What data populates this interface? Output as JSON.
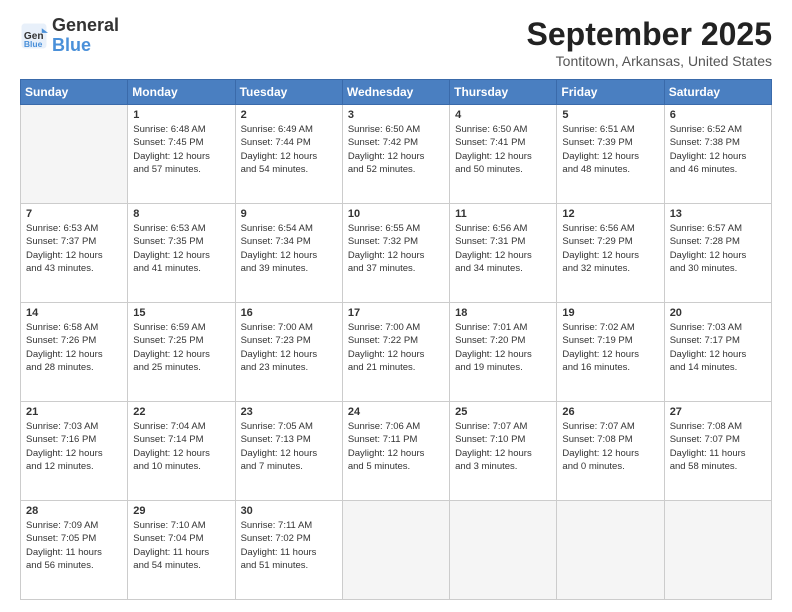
{
  "logo": {
    "line1": "General",
    "line2": "Blue"
  },
  "title": "September 2025",
  "subtitle": "Tontitown, Arkansas, United States",
  "weekdays": [
    "Sunday",
    "Monday",
    "Tuesday",
    "Wednesday",
    "Thursday",
    "Friday",
    "Saturday"
  ],
  "weeks": [
    [
      {
        "day": "",
        "info": ""
      },
      {
        "day": "1",
        "info": "Sunrise: 6:48 AM\nSunset: 7:45 PM\nDaylight: 12 hours\nand 57 minutes."
      },
      {
        "day": "2",
        "info": "Sunrise: 6:49 AM\nSunset: 7:44 PM\nDaylight: 12 hours\nand 54 minutes."
      },
      {
        "day": "3",
        "info": "Sunrise: 6:50 AM\nSunset: 7:42 PM\nDaylight: 12 hours\nand 52 minutes."
      },
      {
        "day": "4",
        "info": "Sunrise: 6:50 AM\nSunset: 7:41 PM\nDaylight: 12 hours\nand 50 minutes."
      },
      {
        "day": "5",
        "info": "Sunrise: 6:51 AM\nSunset: 7:39 PM\nDaylight: 12 hours\nand 48 minutes."
      },
      {
        "day": "6",
        "info": "Sunrise: 6:52 AM\nSunset: 7:38 PM\nDaylight: 12 hours\nand 46 minutes."
      }
    ],
    [
      {
        "day": "7",
        "info": "Sunrise: 6:53 AM\nSunset: 7:37 PM\nDaylight: 12 hours\nand 43 minutes."
      },
      {
        "day": "8",
        "info": "Sunrise: 6:53 AM\nSunset: 7:35 PM\nDaylight: 12 hours\nand 41 minutes."
      },
      {
        "day": "9",
        "info": "Sunrise: 6:54 AM\nSunset: 7:34 PM\nDaylight: 12 hours\nand 39 minutes."
      },
      {
        "day": "10",
        "info": "Sunrise: 6:55 AM\nSunset: 7:32 PM\nDaylight: 12 hours\nand 37 minutes."
      },
      {
        "day": "11",
        "info": "Sunrise: 6:56 AM\nSunset: 7:31 PM\nDaylight: 12 hours\nand 34 minutes."
      },
      {
        "day": "12",
        "info": "Sunrise: 6:56 AM\nSunset: 7:29 PM\nDaylight: 12 hours\nand 32 minutes."
      },
      {
        "day": "13",
        "info": "Sunrise: 6:57 AM\nSunset: 7:28 PM\nDaylight: 12 hours\nand 30 minutes."
      }
    ],
    [
      {
        "day": "14",
        "info": "Sunrise: 6:58 AM\nSunset: 7:26 PM\nDaylight: 12 hours\nand 28 minutes."
      },
      {
        "day": "15",
        "info": "Sunrise: 6:59 AM\nSunset: 7:25 PM\nDaylight: 12 hours\nand 25 minutes."
      },
      {
        "day": "16",
        "info": "Sunrise: 7:00 AM\nSunset: 7:23 PM\nDaylight: 12 hours\nand 23 minutes."
      },
      {
        "day": "17",
        "info": "Sunrise: 7:00 AM\nSunset: 7:22 PM\nDaylight: 12 hours\nand 21 minutes."
      },
      {
        "day": "18",
        "info": "Sunrise: 7:01 AM\nSunset: 7:20 PM\nDaylight: 12 hours\nand 19 minutes."
      },
      {
        "day": "19",
        "info": "Sunrise: 7:02 AM\nSunset: 7:19 PM\nDaylight: 12 hours\nand 16 minutes."
      },
      {
        "day": "20",
        "info": "Sunrise: 7:03 AM\nSunset: 7:17 PM\nDaylight: 12 hours\nand 14 minutes."
      }
    ],
    [
      {
        "day": "21",
        "info": "Sunrise: 7:03 AM\nSunset: 7:16 PM\nDaylight: 12 hours\nand 12 minutes."
      },
      {
        "day": "22",
        "info": "Sunrise: 7:04 AM\nSunset: 7:14 PM\nDaylight: 12 hours\nand 10 minutes."
      },
      {
        "day": "23",
        "info": "Sunrise: 7:05 AM\nSunset: 7:13 PM\nDaylight: 12 hours\nand 7 minutes."
      },
      {
        "day": "24",
        "info": "Sunrise: 7:06 AM\nSunset: 7:11 PM\nDaylight: 12 hours\nand 5 minutes."
      },
      {
        "day": "25",
        "info": "Sunrise: 7:07 AM\nSunset: 7:10 PM\nDaylight: 12 hours\nand 3 minutes."
      },
      {
        "day": "26",
        "info": "Sunrise: 7:07 AM\nSunset: 7:08 PM\nDaylight: 12 hours\nand 0 minutes."
      },
      {
        "day": "27",
        "info": "Sunrise: 7:08 AM\nSunset: 7:07 PM\nDaylight: 11 hours\nand 58 minutes."
      }
    ],
    [
      {
        "day": "28",
        "info": "Sunrise: 7:09 AM\nSunset: 7:05 PM\nDaylight: 11 hours\nand 56 minutes."
      },
      {
        "day": "29",
        "info": "Sunrise: 7:10 AM\nSunset: 7:04 PM\nDaylight: 11 hours\nand 54 minutes."
      },
      {
        "day": "30",
        "info": "Sunrise: 7:11 AM\nSunset: 7:02 PM\nDaylight: 11 hours\nand 51 minutes."
      },
      {
        "day": "",
        "info": ""
      },
      {
        "day": "",
        "info": ""
      },
      {
        "day": "",
        "info": ""
      },
      {
        "day": "",
        "info": ""
      }
    ]
  ]
}
